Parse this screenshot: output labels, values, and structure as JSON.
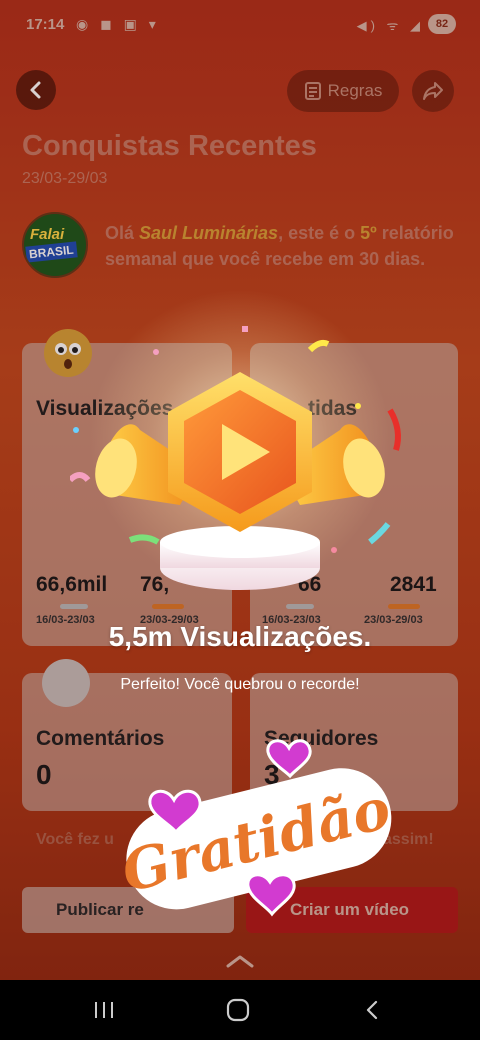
{
  "status_bar": {
    "time": "17:14",
    "left_icons": "◉ ◼ ▣ ▾",
    "right_icons": "◀) ᯤ ◢",
    "battery": "82"
  },
  "header": {
    "back_icon": "chevron-left-icon",
    "rules_label": "Regras",
    "share_icon": "share-icon"
  },
  "title": "Conquistas Recentes",
  "date_range": "23/03-29/03",
  "profile": {
    "logo_top": "Falai",
    "logo_bottom": "BRASIL",
    "text_prefix": "Olá ",
    "name": "Saul Luminárias",
    "text_mid": ", este é o ",
    "ordinal": "5º",
    "text_suffix": " relatório semanal que você recebe em 30 dias."
  },
  "cards": {
    "views": {
      "label": "Visualizações",
      "prev_value": "66,6mil",
      "curr_value": "76,",
      "prev_date": "16/03-23/03",
      "curr_date": "23/03-29/03"
    },
    "shares": {
      "label": "tidas",
      "prev_value": "66",
      "curr_value": "2841",
      "prev_date": "16/03-23/03",
      "curr_date": "23/03-29/03"
    },
    "comments": {
      "label": "Comentários",
      "value": "0"
    },
    "followers": {
      "label": "Seguidores",
      "value": "3"
    }
  },
  "motivation_left": "Você fez u",
  "motivation_right": "assim!",
  "buttons": {
    "publish": "Publicar re",
    "create": "Criar um vídeo"
  },
  "overlay": {
    "headline": "5,5m Visualizações.",
    "subline": "Perfeito! Você quebrou o recorde!",
    "sticker_text": "Gratidão"
  },
  "colors": {
    "background": "#b4321d",
    "accent_orange": "#f28a1c",
    "create_button": "#b31c1c",
    "sticker_text": "#e8772a",
    "heart": "#d23bd0"
  }
}
